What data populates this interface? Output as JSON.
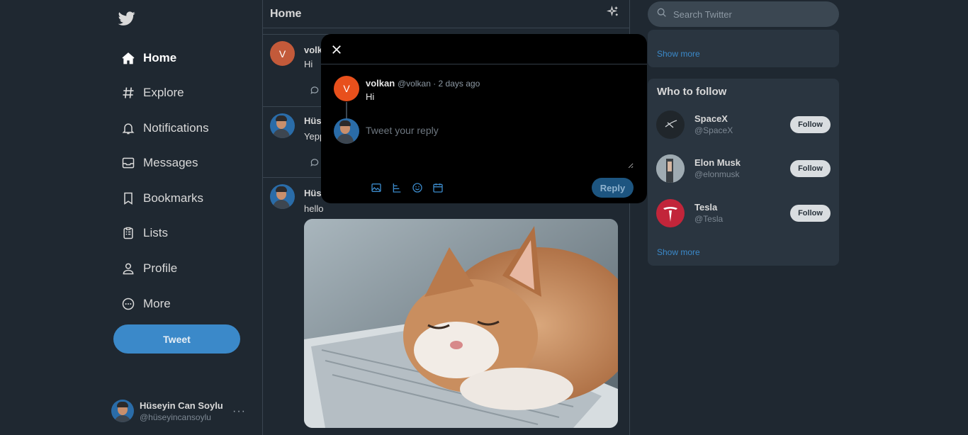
{
  "nav": {
    "items": [
      {
        "label": "Home",
        "icon": "home-icon"
      },
      {
        "label": "Explore",
        "icon": "hashtag-icon"
      },
      {
        "label": "Notifications",
        "icon": "bell-icon"
      },
      {
        "label": "Messages",
        "icon": "envelope-icon"
      },
      {
        "label": "Bookmarks",
        "icon": "bookmark-icon"
      },
      {
        "label": "Lists",
        "icon": "list-icon"
      },
      {
        "label": "Profile",
        "icon": "person-icon"
      },
      {
        "label": "More",
        "icon": "more-circle-icon"
      }
    ],
    "tweet_button": "Tweet"
  },
  "current_user": {
    "name": "Hüseyin Can Soylu",
    "handle": "@hüseyincansoylu"
  },
  "feed": {
    "title": "Home",
    "tweets": [
      {
        "name": "volk",
        "text": "Hi",
        "avatar_letter": "V"
      },
      {
        "name": "Hüs",
        "text": "Yepp"
      },
      {
        "name": "Hüs",
        "text": "hello"
      }
    ]
  },
  "search": {
    "placeholder": "Search Twitter"
  },
  "trends_panel": {
    "show_more": "Show more"
  },
  "who_to_follow": {
    "title": "Who to follow",
    "accounts": [
      {
        "name": "SpaceX",
        "handle": "@SpaceX",
        "button": "Follow"
      },
      {
        "name": "Elon Musk",
        "handle": "@elonmusk",
        "button": "Follow"
      },
      {
        "name": "Tesla",
        "handle": "@Tesla",
        "button": "Follow"
      }
    ],
    "show_more": "Show more"
  },
  "reply_modal": {
    "original": {
      "avatar_letter": "V",
      "name": "volkan",
      "meta": "@volkan · 2 days ago",
      "text": "Hi"
    },
    "reply_placeholder": "Tweet your reply",
    "reply_button": "Reply",
    "tools": [
      "image-icon",
      "gif-icon",
      "emoji-icon",
      "schedule-icon"
    ]
  },
  "colors": {
    "background": "#1f2831",
    "accent": "#3b89c9",
    "tesla_red": "#c2253a",
    "volkan_orange": "#e8501c"
  }
}
